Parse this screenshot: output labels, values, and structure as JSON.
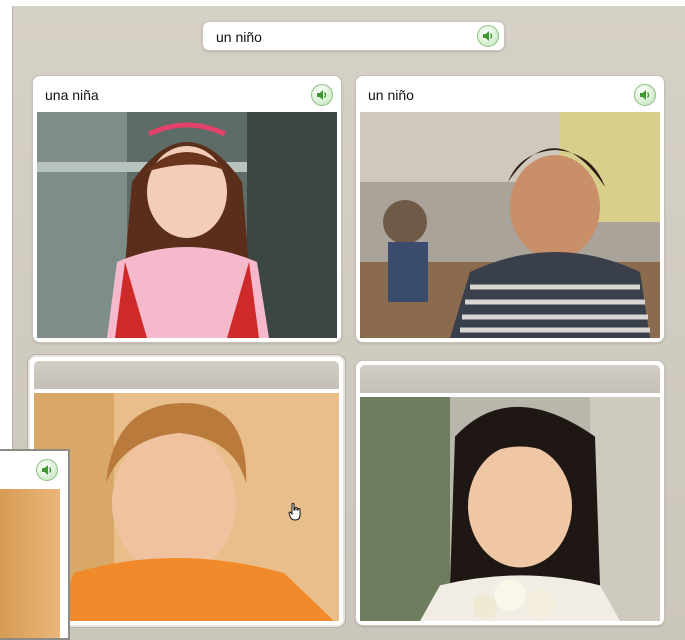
{
  "prompt": {
    "text": "un niño",
    "audio_icon": "speaker-icon"
  },
  "cards": [
    {
      "label": "una niña",
      "audio_icon": "speaker-icon",
      "photo": "girl-pink-sweater"
    },
    {
      "label": "un niño",
      "audio_icon": "speaker-icon",
      "photo": "boy-striped-sweater"
    },
    {
      "label": "",
      "photo": "boy-orange-shirt",
      "state": "hover-selected"
    },
    {
      "label": "",
      "photo": "girl-flowers"
    }
  ],
  "overlay": {
    "audio_icon": "speaker-icon"
  },
  "colors": {
    "stage": "#d2cdc3",
    "speaker": "#5aa84a"
  }
}
